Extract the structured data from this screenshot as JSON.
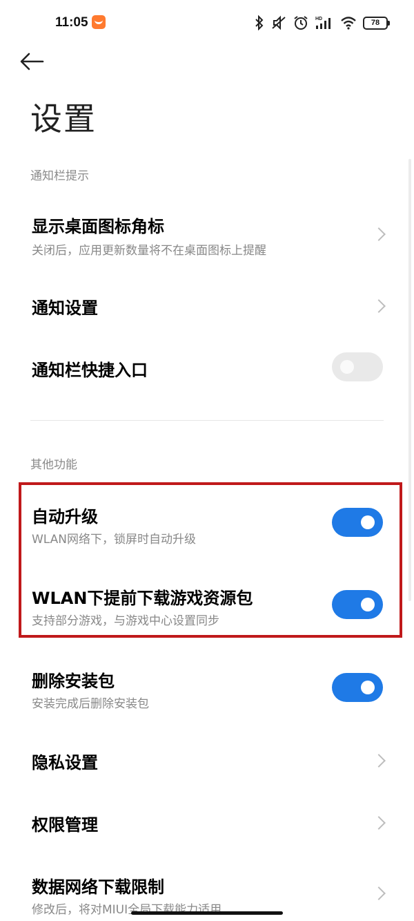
{
  "status_bar": {
    "time": "11:05",
    "battery": "78",
    "icons": [
      "bluetooth-icon",
      "mute-icon",
      "alarm-icon",
      "hd-signal-icon",
      "wifi-icon",
      "battery-icon"
    ]
  },
  "header": {
    "back_icon": "back-arrow-icon",
    "title": "设置"
  },
  "sections": [
    {
      "header": "通知栏提示",
      "items": [
        {
          "title": "显示桌面图标角标",
          "subtitle": "关闭后，应用更新数量将不在桌面图标上提醒",
          "control": "chevron"
        },
        {
          "title": "通知设置",
          "control": "chevron"
        },
        {
          "title": "通知栏快捷入口",
          "control": "toggle",
          "on": false
        }
      ]
    },
    {
      "header": "其他功能",
      "items": [
        {
          "title": "自动升级",
          "subtitle": "WLAN网络下，锁屏时自动升级",
          "control": "toggle",
          "on": true
        },
        {
          "title": "WLAN下提前下载游戏资源包",
          "subtitle": "支持部分游戏，与游戏中心设置同步",
          "control": "toggle",
          "on": true
        },
        {
          "title": "删除安装包",
          "subtitle": "安装完成后删除安装包",
          "control": "toggle",
          "on": true
        },
        {
          "title": "隐私设置",
          "control": "chevron"
        },
        {
          "title": "权限管理",
          "control": "chevron"
        },
        {
          "title": "数据网络下载限制",
          "subtitle": "修改后，将对MIUI全局下载能力适用",
          "control": "chevron"
        }
      ]
    }
  ],
  "colors": {
    "toggle_on": "#1f7ae6",
    "toggle_off": "#e9e9e9",
    "highlight": "#c0191b"
  }
}
